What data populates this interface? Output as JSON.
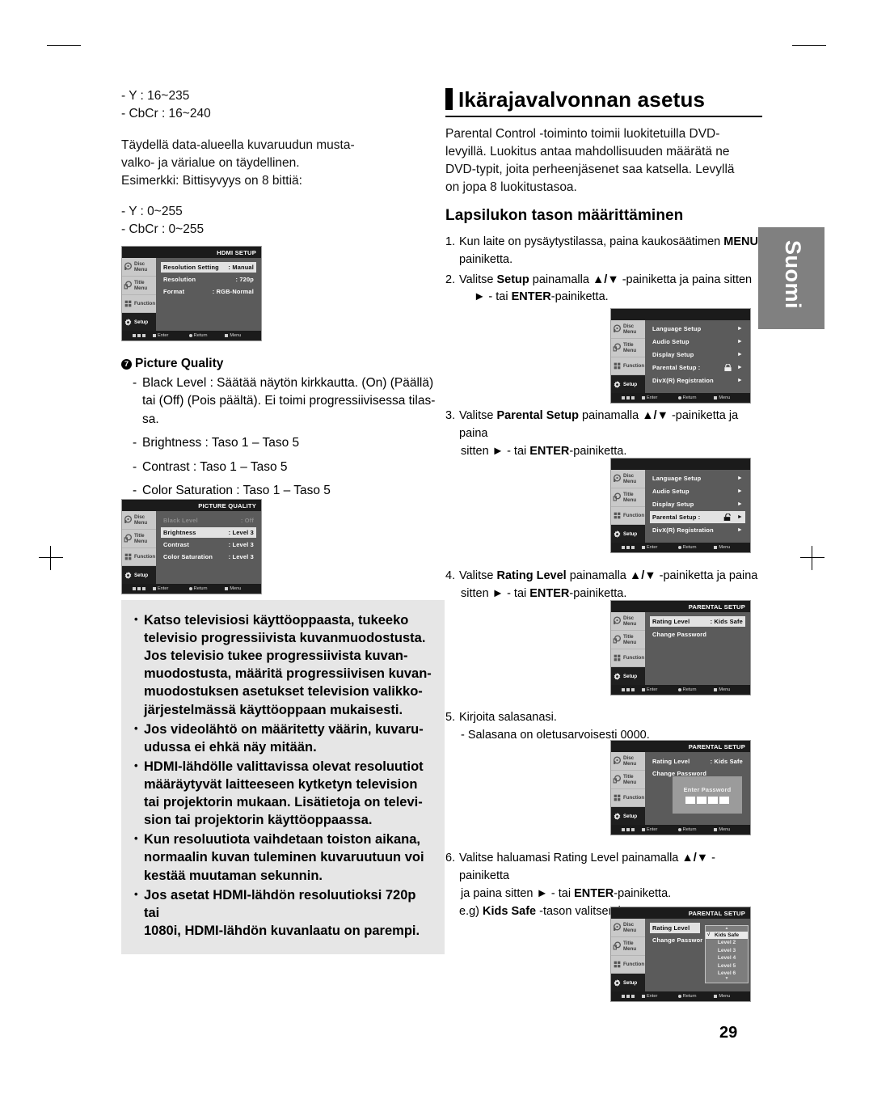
{
  "page": {
    "number": "29",
    "language_tab": "Suomi"
  },
  "left": {
    "range_lines": [
      "- Y : 16~235",
      "- CbCr : 16~240"
    ],
    "paragraph": [
      "Täydellä data-alueella kuvaruudun musta-",
      "valko- ja värialue on täydellinen.",
      "Esimerkki: Bittisyvyys on 8 bittiä:"
    ],
    "range_lines2": [
      "- Y : 0~255",
      "- CbCr : 0~255"
    ],
    "picture_quality": {
      "marker": "7",
      "heading": "Picture Quality",
      "items": [
        [
          "Black Level : Säätää näytön kirkkautta. (On) (Päällä)",
          "tai (Off) (Pois päältä). Ei toimi progressiivisessa tilas-",
          "sa."
        ],
        [
          "Brightness : Taso 1 – Taso 5"
        ],
        [
          "Contrast : Taso 1 – Taso 5"
        ],
        [
          "Color Saturation : Taso 1 – Taso 5"
        ]
      ]
    },
    "notes": [
      [
        "Katso televisiosi käyttöoppaasta, tukeeko",
        "televisio progressiivista kuvanmuodostusta.",
        "Jos televisio tukee progressiivista kuvan-",
        "muodostusta, määritä progressiivisen kuvan-",
        "muodostuksen asetukset television valikko-",
        "järjestelmässä käyttöoppaan mukaisesti."
      ],
      [
        "Jos videolähtö on määritetty väärin, kuvaru-",
        "udussa ei ehkä näy mitään."
      ],
      [
        "HDMI-lähdölle valittavissa olevat resoluutiot",
        "määräytyvät laitteeseen kytketyn television",
        "tai projektorin mukaan. Lisätietoja on televi-",
        "sion tai projektorin käyttöoppaassa."
      ],
      [
        "Kun resoluutiota vaihdetaan toiston aikana,",
        "normaalin kuvan tuleminen kuvaruutuun voi",
        "kestää muutaman sekunnin."
      ],
      [
        "Jos asetat HDMI-lähdön resoluutioksi 720p tai",
        "1080i, HDMI-lähdön kuvanlaatu on parempi."
      ]
    ]
  },
  "right": {
    "section_title": "Ikärajavalvonnan asetus",
    "intro": [
      "Parental Control -toiminto toimii luokitetuilla DVD-",
      "levyillä. Luokitus antaa mahdollisuuden määrätä ne",
      "DVD-typit, joita perheenjäsenet saa katsella. Levyllä",
      "on jopa 8 luokitustasoa."
    ],
    "sub_title": "Lapsilukon tason määrittäminen",
    "steps": [
      {
        "num": "1.",
        "l1_a": "Kun laite on pysäytystilassa, paina kaukosäätimen ",
        "l1_b": "MENU",
        "l1_c": "-",
        "l2": "painiketta."
      },
      {
        "num": "2.",
        "a": "Valitse ",
        "b": "Setup",
        "c": " painamalla ",
        "keys": "▲/▼",
        "d": " -painiketta ja paina sitten",
        "l2_pre": "► - tai ",
        "l2_b": "ENTER",
        "l2_post": "-painiketta."
      },
      {
        "num": "3.",
        "a": "Valitse ",
        "b": "Parental Setup",
        "c": " painamalla ",
        "keys": "▲/▼",
        "d": " -painiketta ja paina",
        "l2_pre": "sitten ► - tai ",
        "l2_b": "ENTER",
        "l2_post": "-painiketta."
      },
      {
        "num": "4.",
        "a": "Valitse ",
        "b": "Rating Level",
        "c": " painamalla ",
        "keys": "▲/▼",
        "d": " -painiketta ja paina",
        "l2_pre": "sitten ► - tai ",
        "l2_b": "ENTER",
        "l2_post": "-painiketta."
      },
      {
        "num": "5.",
        "l1": "Kirjoita salasanasi.",
        "l2": "- Salasana on oletusarvoisesti 0000."
      },
      {
        "num": "6.",
        "a": "Valitse haluamasi Rating Level painamalla ",
        "keys": "▲/▼",
        "d": " -painiketta",
        "l2_pre": "ja paina sitten ► - tai ",
        "l2_b": "ENTER",
        "l2_post": "-painiketta.",
        "l3_pre": "e.g) ",
        "l3_b": "Kids Safe",
        "l3_post": " -tason valitseminen."
      }
    ]
  },
  "osd": {
    "rail": [
      {
        "label": "Disc Menu",
        "icon": "disc-menu-icon"
      },
      {
        "label": "Title Menu",
        "icon": "title-menu-icon"
      },
      {
        "label": "Function",
        "icon": "function-icon"
      },
      {
        "label": "Setup",
        "icon": "gear-icon"
      }
    ],
    "footer": {
      "enter": "Enter",
      "return": "Return",
      "menu": "Menu"
    },
    "hdmi_setup": {
      "title": "HDMI SETUP",
      "rows": [
        {
          "label": "Resolution Setting",
          "value": ": Manual",
          "selected": true
        },
        {
          "label": "Resolution",
          "value": ": 720p",
          "selected": false
        },
        {
          "label": "Format",
          "value": ": RGB-Normal",
          "selected": false
        }
      ]
    },
    "picture_quality": {
      "title": "PICTURE QUALITY",
      "rows": [
        {
          "label": "Black Level",
          "value": ": Off",
          "dim": true
        },
        {
          "label": "Brightness",
          "value": ": Level 3",
          "selected": true
        },
        {
          "label": "Contrast",
          "value": ": Level 3"
        },
        {
          "label": "Color Saturation",
          "value": ": Level 3"
        }
      ]
    },
    "setup_menu": {
      "title": "",
      "rows": [
        {
          "label": "Language Setup",
          "arrow": "►"
        },
        {
          "label": "Audio Setup",
          "arrow": "►"
        },
        {
          "label": "Display Setup",
          "arrow": "►"
        },
        {
          "label": "Parental Setup :",
          "arrow": "►",
          "lock": "lock-closed-icon"
        },
        {
          "label": "DivX(R) Registration",
          "arrow": "►"
        }
      ]
    },
    "setup_menu_selected": {
      "title": "",
      "rows": [
        {
          "label": "Language Setup",
          "arrow": "►"
        },
        {
          "label": "Audio Setup",
          "arrow": "►"
        },
        {
          "label": "Display Setup",
          "arrow": "►"
        },
        {
          "label": "Parental Setup :",
          "arrow": "►",
          "lock": "lock-open-icon",
          "selected": true
        },
        {
          "label": "DivX(R) Registration",
          "arrow": "►"
        }
      ]
    },
    "parental_setup": {
      "title": "PARENTAL SETUP",
      "rows": [
        {
          "label": "Rating Level",
          "value": ": Kids Safe",
          "selected": true
        },
        {
          "label": "Change Password",
          "value": ""
        }
      ]
    },
    "parental_password": {
      "title": "PARENTAL SETUP",
      "rows": [
        {
          "label": "Rating Level",
          "value": ": Kids Safe"
        },
        {
          "label": "Change Password",
          "value": ""
        }
      ],
      "dialog": {
        "title": "Enter Password",
        "digits": 4
      }
    },
    "parental_rating": {
      "title": "PARENTAL SETUP",
      "rows": [
        {
          "label": "Rating Level",
          "value": "",
          "selected": true
        },
        {
          "label": "Change Passwor",
          "value": ""
        }
      ],
      "dropdown": {
        "options": [
          "Kids Safe",
          "Level 2",
          "Level 3",
          "Level 4",
          "Level 5",
          "Level 6"
        ],
        "selected": "Kids Safe",
        "up": "▲",
        "down": "▼"
      }
    }
  }
}
